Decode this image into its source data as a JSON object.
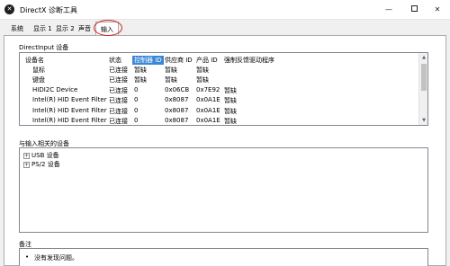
{
  "window": {
    "title": "DirectX 诊断工具",
    "icon_letter": "✕",
    "min": "—",
    "close": "✕"
  },
  "tabs": [
    {
      "label": "系统"
    },
    {
      "label": "显示 1"
    },
    {
      "label": "显示 2"
    },
    {
      "label": "声音"
    },
    {
      "label": "输入"
    }
  ],
  "directinput": {
    "section_title": "DirectInput 设备",
    "columns": [
      "设备名",
      "状态",
      "控制器 ID",
      "供应商 ID",
      "产品 ID",
      "强制反馈驱动程序"
    ],
    "rows": [
      [
        "鼠标",
        "已连接",
        "暂缺",
        "暂缺",
        "暂缺",
        ""
      ],
      [
        "键盘",
        "已连接",
        "暂缺",
        "暂缺",
        "暂缺",
        ""
      ],
      [
        "HIDI2C Device",
        "已连接",
        "0",
        "0x06CB",
        "0x7E92",
        "暂缺"
      ],
      [
        "Intel(R) HID Event Filter",
        "已连接",
        "0",
        "0x8087",
        "0x0A1E",
        "暂缺"
      ],
      [
        "Intel(R) HID Event Filter",
        "已连接",
        "0",
        "0x8087",
        "0x0A1E",
        "暂缺"
      ],
      [
        "Intel(R) HID Event Filter",
        "已连接",
        "0",
        "0x8087",
        "0x0A1E",
        "暂缺"
      ]
    ]
  },
  "related": {
    "section_title": "与输入相关的设备",
    "items": [
      {
        "expander": "+",
        "label": "USB 设备"
      },
      {
        "expander": "+",
        "label": "PS/2 设备"
      }
    ]
  },
  "notes": {
    "section_title": "备注",
    "bullet": "•",
    "text": "没有发现问题。"
  },
  "colors": {
    "selected_header": "#3a87d6",
    "annotation_circle": "#d12b2b"
  }
}
